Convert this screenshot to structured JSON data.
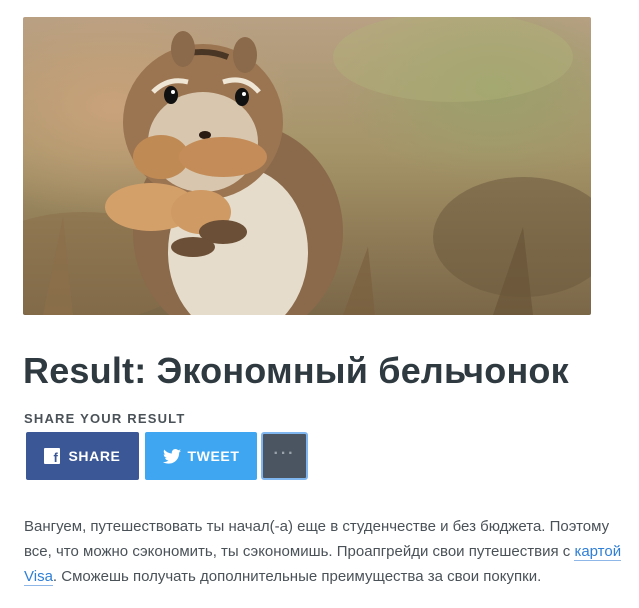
{
  "hero": {
    "image_label": "chipmunk-with-peanuts"
  },
  "result": {
    "title": "Result: Экономный бельчонок"
  },
  "share": {
    "label": "SHARE YOUR RESULT",
    "facebook_label": "SHARE",
    "facebook_icon": "f",
    "twitter_label": "TWEET",
    "more_label": "···"
  },
  "description": {
    "text_before": "Вангуем, путешествовать ты начал(-а) еще в студенчестве и без бюджета. Поэтому все, что можно сэкономить, ты сэкономишь. Проапгрейди свои путешествия с ",
    "link_text": "картой Visa",
    "text_after": ". Сможешь получать дополнительные преимущества за свои покупки."
  },
  "colors": {
    "facebook": "#3b5795",
    "twitter": "#3fa7f2",
    "more": "#4a5561",
    "link": "#2f7fd6",
    "title": "#2f3940"
  }
}
